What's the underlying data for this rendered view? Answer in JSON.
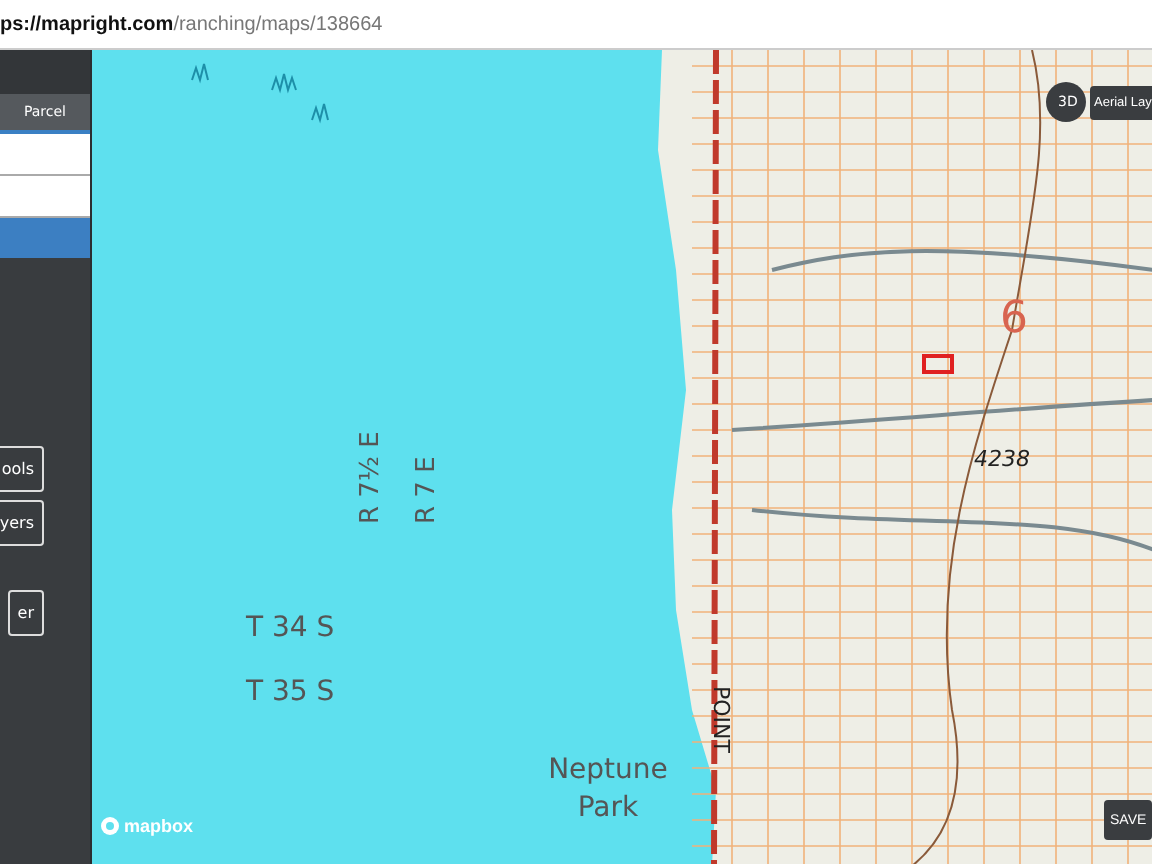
{
  "address_bar": {
    "url_host": "ps://mapright.com",
    "url_path": "/ranching/maps/138664"
  },
  "sidebar": {
    "tabs": [
      {
        "label": "Parcel",
        "selected": true
      }
    ],
    "buttons": [
      "ools",
      "yers",
      "er"
    ]
  },
  "map": {
    "labels": [
      {
        "text": "R 7½ E",
        "kind": "vertical"
      },
      {
        "text": "R 7 E",
        "kind": "vertical"
      },
      {
        "text": "T 34 S",
        "kind": "plain"
      },
      {
        "text": "T 35 S",
        "kind": "plain"
      },
      {
        "text": "Neptune Park",
        "kind": "park"
      },
      {
        "text": "POINT",
        "kind": "road"
      },
      {
        "text": "6",
        "kind": "section"
      },
      {
        "text": "4238",
        "kind": "elevation"
      }
    ],
    "toggle_3d": "3D",
    "layer_button": "Aerial Lay",
    "save_button": "SAVE",
    "attribution": "mapbox"
  }
}
